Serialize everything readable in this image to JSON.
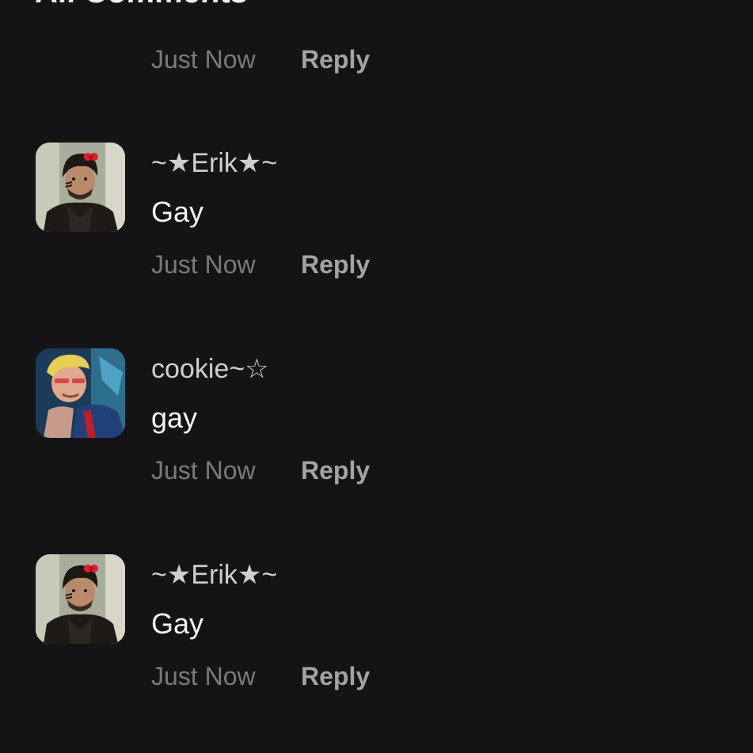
{
  "section": {
    "title": "All Comments"
  },
  "top_meta": {
    "time": "Just Now",
    "reply_label": "Reply"
  },
  "comments": [
    {
      "author": "~★Erik★~",
      "text": "Gay",
      "time": "Just Now",
      "reply_label": "Reply",
      "avatar_icon": "profile-photo-erik"
    },
    {
      "author": "cookie~☆",
      "text": "gay",
      "time": "Just Now",
      "reply_label": "Reply",
      "avatar_icon": "profile-photo-cookie"
    },
    {
      "author": "~★Erik★~",
      "text": "Gay",
      "time": "Just Now",
      "reply_label": "Reply",
      "avatar_icon": "profile-photo-erik"
    }
  ],
  "colors": {
    "background": "#141416",
    "title": "#f2f2f2",
    "author": "#cfcfd2",
    "body": "#f4f4f4",
    "time": "#7a7a7e",
    "reply": "#a3a3a7"
  }
}
